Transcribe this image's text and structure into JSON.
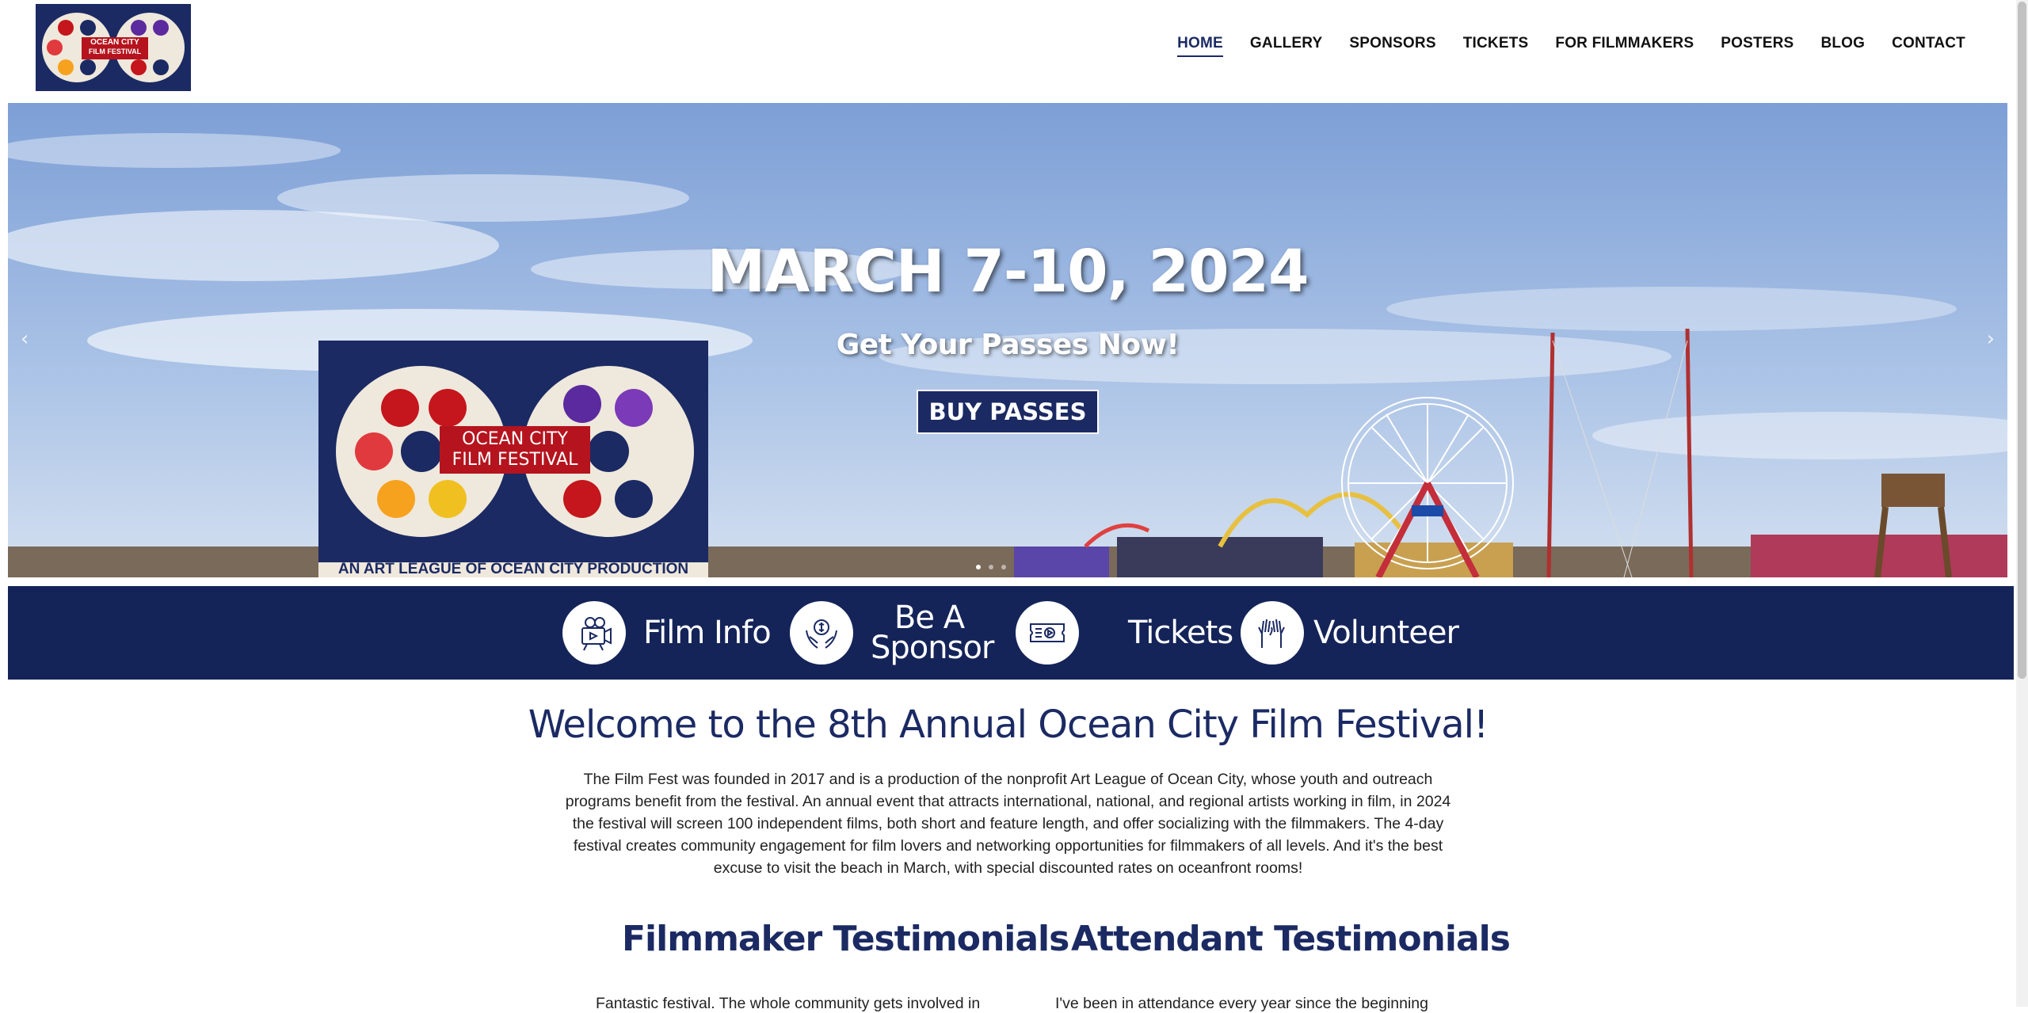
{
  "header": {
    "logo_text_line1": "OCEAN CITY",
    "logo_text_line2": "FILM FESTIVAL",
    "nav": [
      {
        "label": "HOME",
        "active": true
      },
      {
        "label": "GALLERY"
      },
      {
        "label": "SPONSORS"
      },
      {
        "label": "TICKETS"
      },
      {
        "label": "FOR FILMMAKERS"
      },
      {
        "label": "POSTERS"
      },
      {
        "label": "BLOG"
      },
      {
        "label": "CONTACT"
      }
    ]
  },
  "hero": {
    "title": "MARCH 7-10, 2024",
    "subtitle": "Get Your Passes Now!",
    "button": "BUY PASSES",
    "poster_line1": "OCEAN CITY",
    "poster_line2": "FILM FESTIVAL",
    "poster_tagline": "AN ART LEAGUE OF OCEAN CITY PRODUCTION",
    "prev_arrow": "‹",
    "next_arrow": "›",
    "slide_count": 3,
    "active_slide": 1
  },
  "quicklinks": [
    {
      "label": "Film Info",
      "icon": "film-camera-icon"
    },
    {
      "label": "Be A Sponsor",
      "icon": "money-hands-icon"
    },
    {
      "label": "Tickets",
      "icon": "ticket-icon"
    },
    {
      "label": "Volunteer",
      "icon": "raised-hands-icon"
    }
  ],
  "welcome": {
    "title": "Welcome to the 8th Annual Ocean City Film Festival!",
    "text": "The Film Fest was founded in 2017 and is a production of the nonprofit Art League of Ocean City, whose youth and outreach programs benefit from the festival. An annual event that attracts international, national, and regional artists working in film, in 2024 the festival will screen 100 independent films, both short and feature length, and offer socializing with the filmmakers. The 4-day festival creates community engagement for film lovers and networking opportunities for filmmakers of all levels. And it's the best excuse to visit the beach in March, with special discounted rates on oceanfront rooms!"
  },
  "testimonials": {
    "filmmaker_title": "Filmmaker Testimonials",
    "filmmaker_text": "Fantastic festival. The whole community gets involved in",
    "attendant_title": "Attendant Testimonials",
    "attendant_text": "I've been in attendance every year since the beginning"
  },
  "colors": {
    "navy": "#1b2a63",
    "bar": "#142459",
    "poster_red": "#b5141e"
  }
}
